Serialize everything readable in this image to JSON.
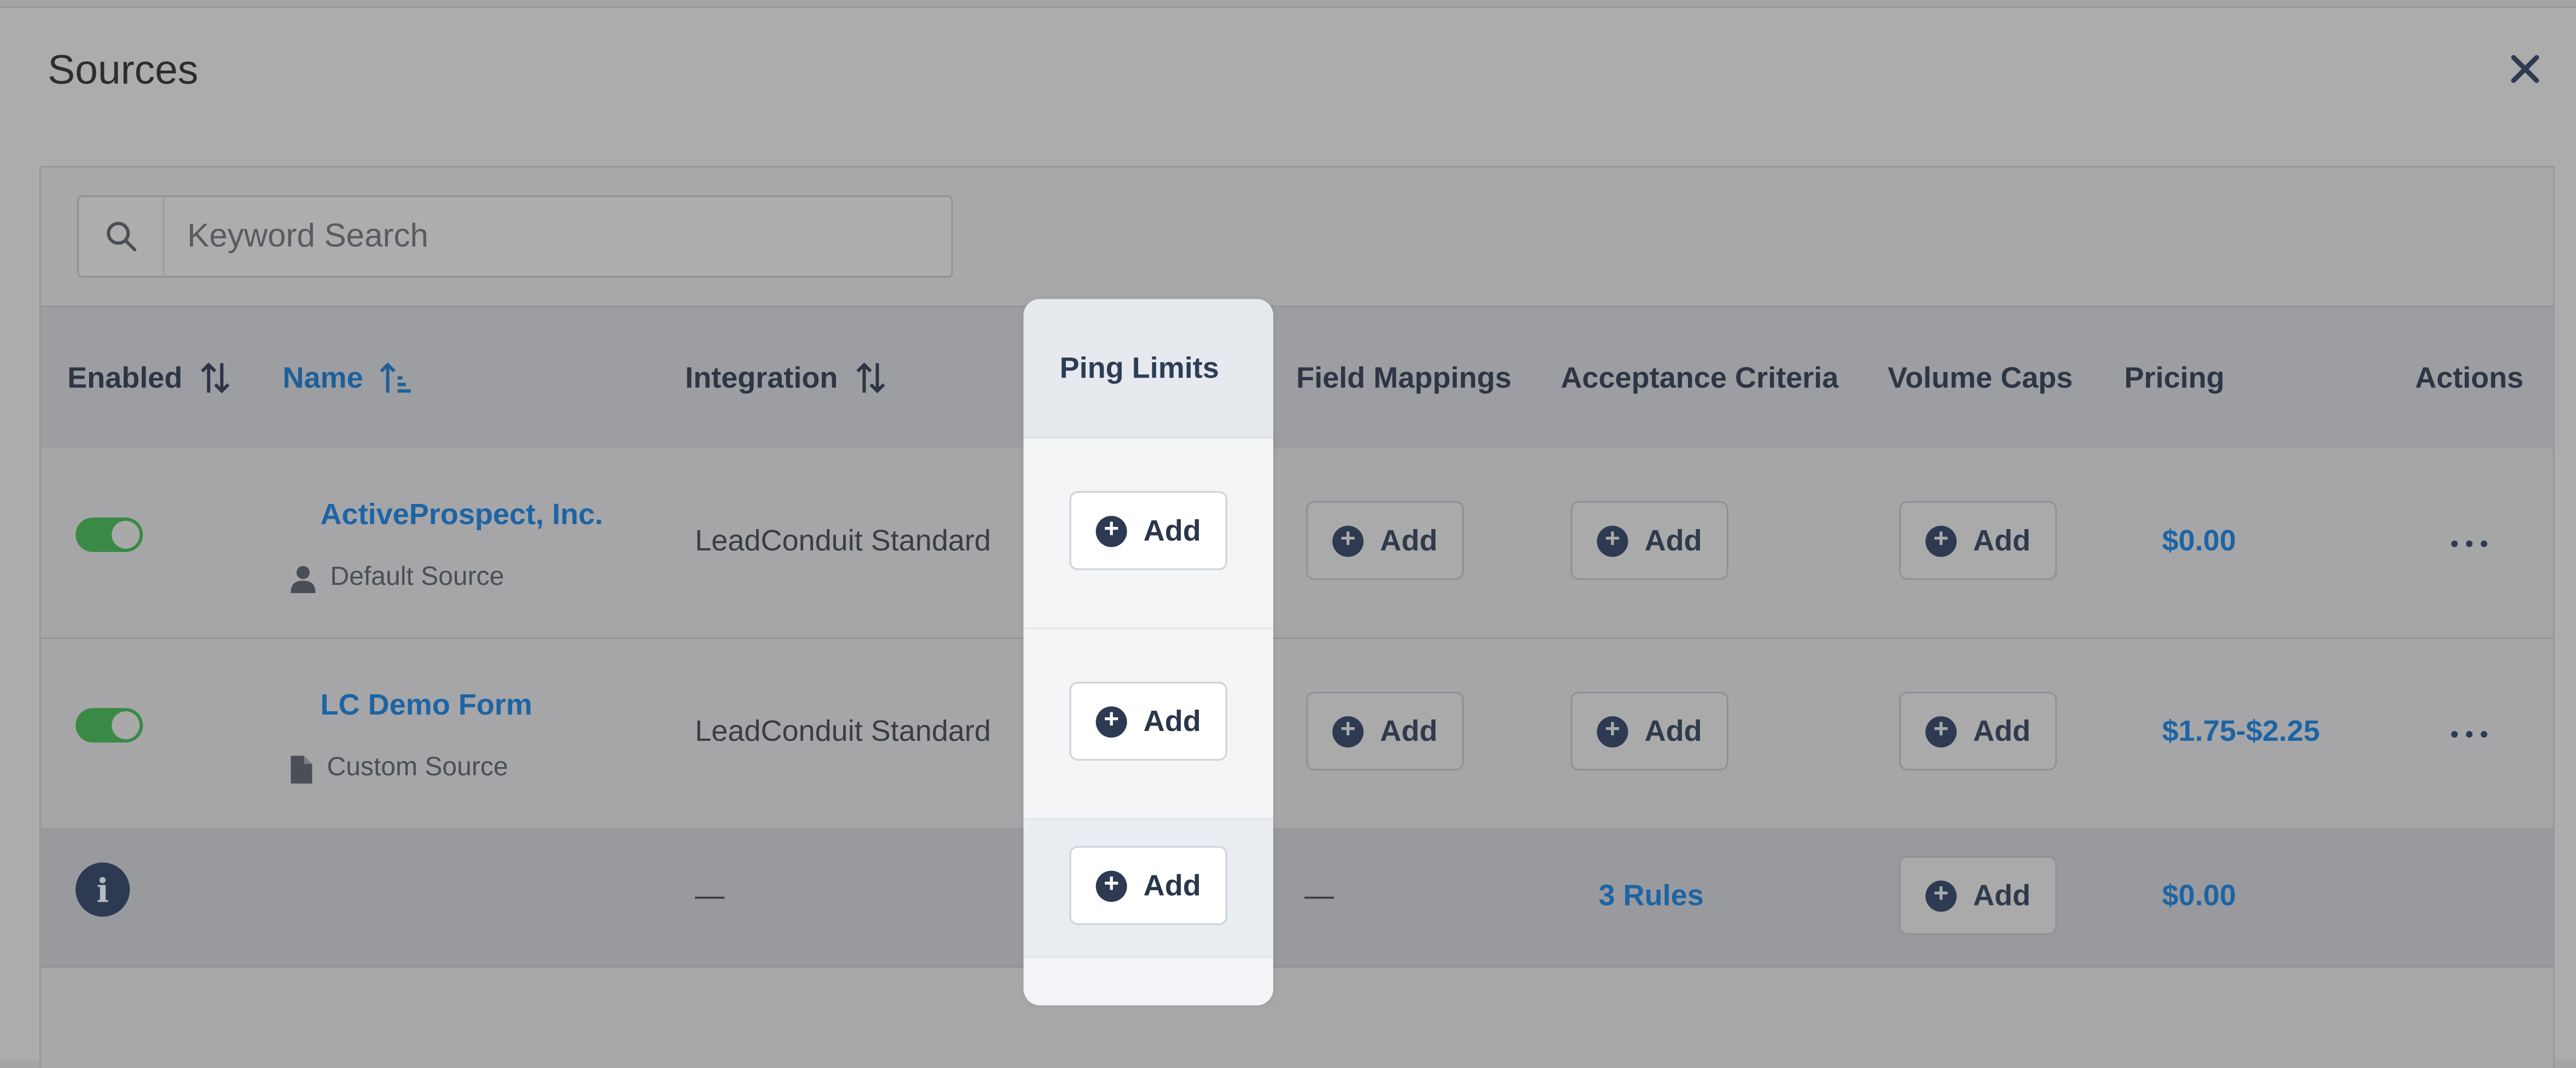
{
  "modal": {
    "title": "Sources",
    "close_icon": "close-icon"
  },
  "search": {
    "placeholder": "Keyword Search",
    "icon": "search-icon"
  },
  "columns": {
    "enabled": "Enabled",
    "name": "Name",
    "integration": "Integration",
    "ping_limits": "Ping Limits",
    "field_mappings": "Field Mappings",
    "acceptance_criteria": "Acceptance Criteria",
    "volume_caps": "Volume Caps",
    "pricing": "Pricing",
    "actions": "Actions"
  },
  "add_label": "Add",
  "rows": [
    {
      "enabled": true,
      "name": "ActiveProspect, Inc.",
      "source_type": "Default Source",
      "source_type_icon": "user-icon",
      "integration": "LeadConduit Standard",
      "pricing": "$0.00"
    },
    {
      "enabled": true,
      "name": "LC Demo Form",
      "source_type": "Custom Source",
      "source_type_icon": "document-icon",
      "integration": "LeadConduit Standard",
      "pricing": "$1.75-$2.25"
    },
    {
      "info_icon": "info-icon",
      "integration": "—",
      "field_mappings": "—",
      "acceptance_criteria": "3 Rules",
      "pricing": "$0.00"
    }
  ],
  "colors": {
    "accent_link": "#1d64a4",
    "toggle_on": "#3a8a45",
    "spotlight_bg": "#f2f4f7"
  }
}
